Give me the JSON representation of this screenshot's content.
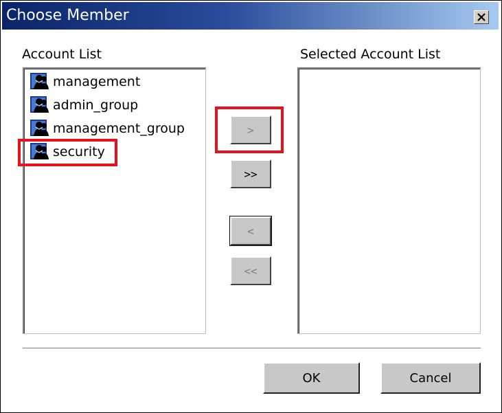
{
  "window": {
    "title": "Choose Member",
    "close_icon": "close-icon"
  },
  "left_panel": {
    "label": "Account List",
    "items": [
      {
        "label": "management",
        "icon": "group-icon"
      },
      {
        "label": "admin_group",
        "icon": "group-icon"
      },
      {
        "label": "management_group",
        "icon": "group-icon"
      },
      {
        "label": "security",
        "icon": "group-icon"
      }
    ]
  },
  "right_panel": {
    "label": "Selected Account List",
    "items": []
  },
  "transfer_buttons": {
    "add": ">",
    "add_all": ">>",
    "remove": "<",
    "remove_all": "<<"
  },
  "footer": {
    "ok": "OK",
    "cancel": "Cancel"
  },
  "colors": {
    "title_bar_start": "#0a246a",
    "title_bar_end": "#a6caf0",
    "highlight": "#e8101a",
    "button_face": "#c8c8c8"
  }
}
